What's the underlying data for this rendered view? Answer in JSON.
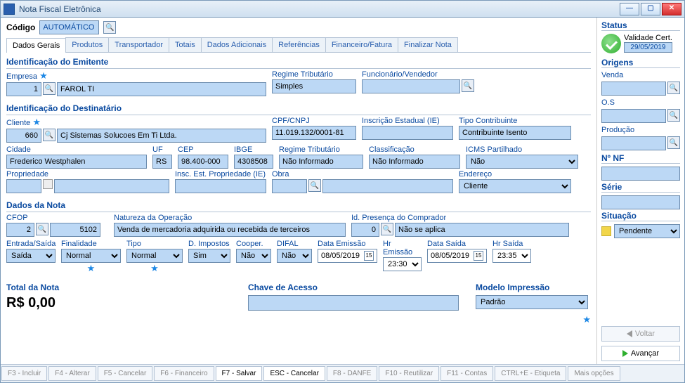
{
  "window": {
    "title": "Nota Fiscal Eletrônica"
  },
  "code": {
    "label": "Código",
    "value": "AUTOMÁTICO"
  },
  "tabs": [
    "Dados Gerais",
    "Produtos",
    "Transportador",
    "Totais",
    "Dados Adicionais",
    "Referências",
    "Financeiro/Fatura",
    "Finalizar Nota"
  ],
  "active_tab": 0,
  "emit": {
    "title": "Identificação do Emitente",
    "empresa_label": "Empresa",
    "empresa_code": "1",
    "empresa_name": "FAROL TI",
    "regime_label": "Regime Tributário",
    "regime_value": "Simples",
    "func_label": "Funcionário/Vendedor",
    "func_value": ""
  },
  "dest": {
    "title": "Identificação do Destinatário",
    "cliente_label": "Cliente",
    "cliente_code": "660",
    "cliente_name": "Cj Sistemas Solucoes Em Ti Ltda.",
    "cpf_label": "CPF/CNPJ",
    "cpf_value": "11.019.132/0001-81",
    "ie_label": "Inscrição Estadual (IE)",
    "ie_value": "",
    "tipocontrib_label": "Tipo Contribuinte",
    "tipocontrib_value": "Contribuinte Isento",
    "cidade_label": "Cidade",
    "cidade_value": "Frederico Westphalen",
    "uf_label": "UF",
    "uf_value": "RS",
    "cep_label": "CEP",
    "cep_value": "98.400-000",
    "ibge_label": "IBGE",
    "ibge_value": "4308508",
    "regime2_label": "Regime Tributário",
    "regime2_value": "Não Informado",
    "class_label": "Classificação",
    "class_value": "Não Informado",
    "icmsp_label": "ICMS Partilhado",
    "icmsp_value": "Não",
    "prop_label": "Propriedade",
    "prop_value": "",
    "inscprop_label": "Insc. Est. Propriedade (IE)",
    "inscprop_value": "",
    "obra_label": "Obra",
    "obra_value": "",
    "endereco_label": "Endereço",
    "endereco_value": "Cliente"
  },
  "nota": {
    "title": "Dados da Nota",
    "cfop_label": "CFOP",
    "cfop_code": "2",
    "cfop_value": "5102",
    "natop_label": "Natureza da Operação",
    "natop_value": "Venda de mercadoria adquirida ou recebida de terceiros",
    "idpres_label": "Id. Presença do Comprador",
    "idpres_code": "0",
    "idpres_value": "Não se aplica",
    "es_label": "Entrada/Saída",
    "es_value": "Saída",
    "fin_label": "Finalidade",
    "fin_value": "Normal",
    "tipo_label": "Tipo",
    "tipo_value": "Normal",
    "dimp_label": "D. Impostos",
    "dimp_value": "Sim",
    "cooper_label": "Cooper.",
    "cooper_value": "Não",
    "difal_label": "DIFAL",
    "difal_value": "Não",
    "dataem_label": "Data Emissão",
    "dataem_value": "08/05/2019",
    "hrem_label": "Hr Emissão",
    "hrem_value": "23:30",
    "datasaida_label": "Data Saída",
    "datasaida_value": "08/05/2019",
    "hrsaida_label": "Hr Saída",
    "hrsaida_value": "23:35"
  },
  "totals": {
    "total_label": "Total da Nota",
    "total_value": "R$ 0,00",
    "chave_label": "Chave de Acesso",
    "chave_value": "",
    "modelo_label": "Modelo Impressão",
    "modelo_value": "Padrão"
  },
  "side": {
    "status_label": "Status",
    "validade_label": "Validade Cert.",
    "validade_value": "29/05/2019",
    "origens_label": "Origens",
    "venda_label": "Venda",
    "os_label": "O.S",
    "producao_label": "Produção",
    "nf_label": "Nº NF",
    "serie_label": "Série",
    "situacao_label": "Situação",
    "situacao_value": "Pendente",
    "voltar": "Voltar",
    "avancar": "Avançar"
  },
  "fn": {
    "f3": "F3 - Incluir",
    "f4": "F4 - Alterar",
    "f5": "F5 - Cancelar",
    "f6": "F6 - Financeiro",
    "f7": "F7 - Salvar",
    "esc": "ESC - Cancelar",
    "f8": "F8 - DANFE",
    "f10": "F10 - Reutilizar",
    "f11": "F11 - Contas",
    "ctrle": "CTRL+E - Etiqueta",
    "mais": "Mais opções"
  }
}
